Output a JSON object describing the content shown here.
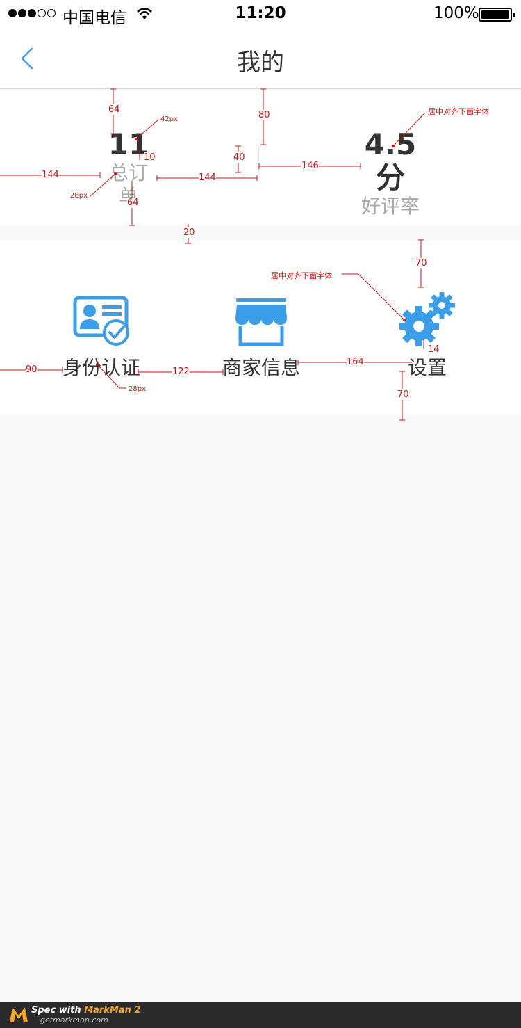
{
  "status_bar": {
    "carrier": "中国电信",
    "time": "11:20",
    "battery": "100%"
  },
  "nav": {
    "title": "我的",
    "back_icon": "chevron-left-icon"
  },
  "stats": [
    {
      "value": "11",
      "label": "总订单"
    },
    {
      "value": "4.5分",
      "label": "好评率"
    }
  ],
  "grid": [
    {
      "label": "身份认证",
      "icon": "id-card-check-icon"
    },
    {
      "label": "商家信息",
      "icon": "storefront-icon"
    },
    {
      "label": "设置",
      "icon": "gears-icon"
    }
  ],
  "annotations": {
    "m64a": "64",
    "m80": "80",
    "m42px": "42px",
    "m10": "10",
    "m40": "40",
    "m144a": "144",
    "m144b": "144",
    "m146": "146",
    "m28pxa": "28px",
    "m64b": "64",
    "m20": "20",
    "center1": "居中对齐下面字体",
    "m70a": "70",
    "center2": "居中对齐下面字体",
    "m14": "14",
    "m90": "90",
    "m122": "122",
    "m164": "164",
    "m28pxb": "28px",
    "m70b": "70"
  },
  "footer": {
    "spec_prefix": "Spec with ",
    "brand": "MarkMan 2",
    "url": "getmarkman.com"
  },
  "colors": {
    "accent": "#3a9de8",
    "annotation": "#d01010"
  }
}
